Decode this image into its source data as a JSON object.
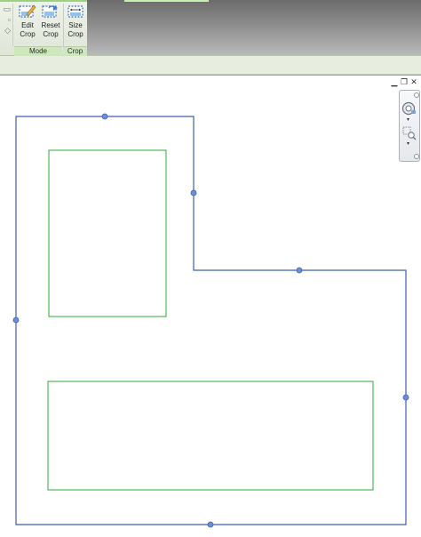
{
  "ribbon": {
    "buttons": {
      "edit_crop": {
        "line1": "Edit",
        "line2": "Crop"
      },
      "reset_crop": {
        "line1": "Reset",
        "line2": "Crop"
      },
      "size_crop": {
        "line1": "Size",
        "line2": "Crop"
      }
    },
    "groups": {
      "mode": "Mode",
      "crop": "Crop"
    }
  },
  "icons": {
    "edit_crop": "edit-crop-icon",
    "reset_crop": "reset-crop-icon",
    "size_crop": "size-crop-icon",
    "minimize": "minimize-icon",
    "restore": "restore-icon",
    "close": "close-icon",
    "wheel": "steering-wheel-icon",
    "zoom": "zoom-region-icon"
  },
  "colors": {
    "crop_boundary": "#3f5fb0",
    "crop_grip": "#6d8fd4",
    "room_region": "#2fa83a",
    "ribbon_accent": "#9bd27d"
  }
}
